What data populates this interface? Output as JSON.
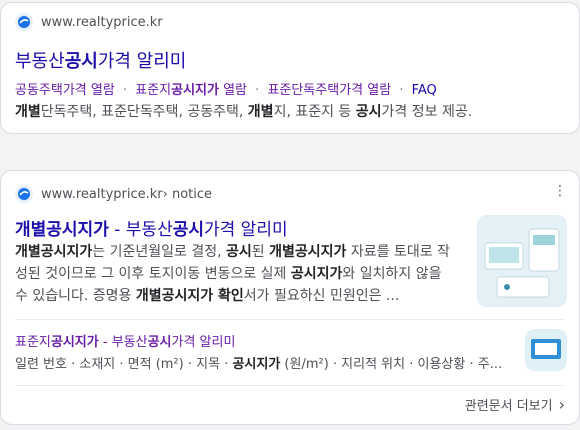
{
  "result1": {
    "source": "www.realtyprice.kr",
    "title_pre": "부동산",
    "title_bold": "공시",
    "title_post": "가격 알리미",
    "sitelinks": [
      {
        "pre": "공동주택가격 열람",
        "bold": "",
        "post": ""
      },
      {
        "pre": "표준지",
        "bold": "공시지가",
        "post": " 열람"
      },
      {
        "pre": "표준단독주택가격 열람",
        "bold": "",
        "post": ""
      },
      {
        "pre": "FAQ",
        "bold": "",
        "post": ""
      }
    ],
    "desc": [
      {
        "b": "개별",
        "t": "단독주택, 표준단독주택, 공동주택, "
      },
      {
        "b": "개별",
        "t": "지, 표준지 등 "
      },
      {
        "b": "공시",
        "t": "가격 정보 제공."
      }
    ]
  },
  "result2": {
    "source": "www.realtyprice.kr",
    "breadcrumb": " › notice",
    "title_bold": "개별공시지가",
    "title_mid": " - 부동산",
    "title_bold2": "공시",
    "title_post": "가격 알리미",
    "desc": [
      {
        "b": "개별공시지가",
        "t": "는 기준년월일로 결정, "
      },
      {
        "b": "공시",
        "t": "된 "
      },
      {
        "b": "개별공시지가",
        "t": " 자료를 토대로 작성된 것이므로 그 이후 토지이동 변동으로 실제 "
      },
      {
        "b": "공시지가",
        "t": "와 일치하지 않을 수 있습니다. 증명용 "
      },
      {
        "b": "개별공시지가 확인",
        "t": "서가 필요하신 민원인은 ..."
      }
    ],
    "sub": {
      "title_pre": "표준지",
      "title_bold": "공시지가",
      "title_mid": " - 부동산",
      "title_bold2": "공시",
      "title_post": "가격 알리미",
      "desc_pre": "일련 번호 · 소재지 · 면적 (m²) · 지목 · ",
      "desc_bold": "공시지가",
      "desc_post": " (원/m²) · 지리적 위치 · 이용상황 · 주..."
    },
    "more_label": "관련문서 더보기",
    "kebab": "⋮",
    "chevron": "›"
  },
  "icons": [
    "globe-favicon-icon",
    "more-vert-icon",
    "chevron-right-icon"
  ],
  "colors": {
    "link": "#1a0dab",
    "visited": "#681da8",
    "text": "#4d5156",
    "bg": "#f1f3f4"
  }
}
